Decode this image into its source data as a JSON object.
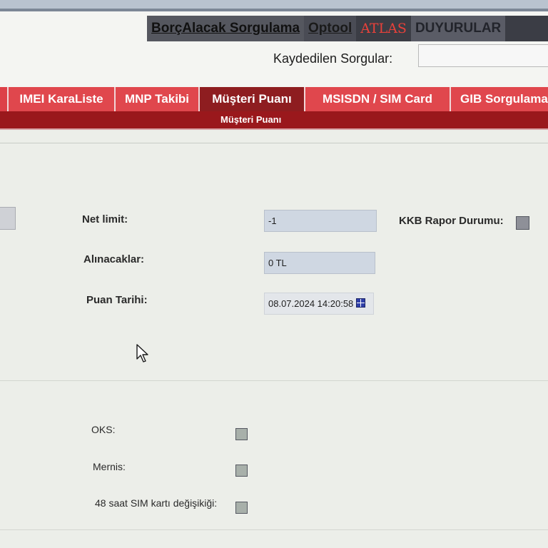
{
  "top_links": [
    {
      "label": "BorçAlacak Sorgulama"
    },
    {
      "label": "Optool"
    },
    {
      "label": "ATLAS"
    },
    {
      "label": "DUYURULAR"
    }
  ],
  "saved_queries": {
    "label": "Kaydedilen Sorgular:",
    "value": ""
  },
  "nav": {
    "tabs": [
      {
        "label": "IMEI KaraListe"
      },
      {
        "label": "MNP Takibi"
      },
      {
        "label": "Müşteri Puanı",
        "active": true
      },
      {
        "label": "MSISDN / SIM Card"
      },
      {
        "label": "GIB Sorgulama"
      }
    ],
    "sub_label": "Müşteri Puanı"
  },
  "form": {
    "net_limit": {
      "label": "Net limit:",
      "value": "-1"
    },
    "alinacaklar": {
      "label": "Alınacaklar:",
      "value": "0 TL"
    },
    "puan_tarihi": {
      "label": "Puan Tarihi:",
      "value": "08.07.2024 14:20:58"
    },
    "kkb": {
      "label": "KKB Rapor Durumu:",
      "checked": false
    }
  },
  "checks": {
    "oks": {
      "label": "OKS:",
      "checked": false
    },
    "mernis": {
      "label": "Mernis:",
      "checked": false
    },
    "sim_change": {
      "label": "48 saat SIM kartı değişikiği:",
      "checked": false
    }
  },
  "icons": [
    "calendar-icon",
    "mouse-cursor-icon"
  ],
  "colors": {
    "nav_red": "#c31d24",
    "nav_active": "#8e1d20",
    "tab_red": "#e0474d",
    "atlas_red": "#e8413a"
  }
}
